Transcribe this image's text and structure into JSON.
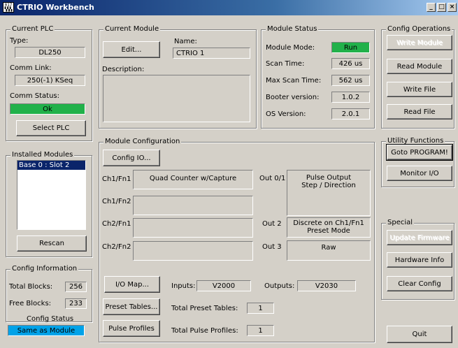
{
  "window": {
    "title": "CTRIO Workbench",
    "icon_text": "017 ▚▚▚"
  },
  "current_plc": {
    "label": "Current PLC",
    "type_label": "Type:",
    "type_value": "DL250",
    "comm_link_label": "Comm Link:",
    "comm_link_value": "250(-1) KSeq",
    "comm_status_label": "Comm Status:",
    "comm_status_value": "Ok",
    "select_plc": "Select PLC"
  },
  "installed_modules": {
    "label": "Installed Modules",
    "items": [
      "Base 0 : Slot 2"
    ],
    "rescan": "Rescan"
  },
  "config_info": {
    "label": "Config Information",
    "total_blocks_label": "Total Blocks:",
    "total_blocks_value": "256",
    "free_blocks_label": "Free Blocks:",
    "free_blocks_value": "233",
    "config_status_label": "Config Status",
    "config_status_value": "Same as Module"
  },
  "current_module": {
    "label": "Current Module",
    "edit": "Edit...",
    "name_label": "Name:",
    "name_value": "CTRIO 1",
    "description_label": "Description:"
  },
  "module_status": {
    "label": "Module Status",
    "mode_label": "Module Mode:",
    "mode_value": "Run",
    "scan_label": "Scan Time:",
    "scan_value": "426 us",
    "max_scan_label": "Max Scan Time:",
    "max_scan_value": "562 us",
    "booter_label": "Booter version:",
    "booter_value": "1.0.2",
    "os_label": "OS Version:",
    "os_value": "2.0.1"
  },
  "config_ops": {
    "label": "Config Operations",
    "write_module": "Write Module",
    "read_module": "Read Module",
    "write_file": "Write File",
    "read_file": "Read File"
  },
  "utility": {
    "label": "Utility Functions",
    "goto_program": "Goto PROGRAM!",
    "monitor_io": "Monitor I/O"
  },
  "special": {
    "label": "Special",
    "update_firmware": "Update Firmware",
    "hardware_info": "Hardware Info",
    "clear_config": "Clear Config"
  },
  "quit": "Quit",
  "module_config": {
    "label": "Module Configuration",
    "config_io": "Config IO...",
    "ch1fn1_label": "Ch1/Fn1",
    "ch1fn1_value": "Quad Counter w/Capture",
    "ch1fn2_label": "Ch1/Fn2",
    "ch2fn1_label": "Ch2/Fn1",
    "ch2fn2_label": "Ch2/Fn2",
    "out01_label": "Out 0/1",
    "out01_value_line1": "Pulse Output",
    "out01_value_line2": "Step / Direction",
    "out2_label": "Out 2",
    "out2_value_line1": "Discrete on Ch1/Fn1",
    "out2_value_line2": "Preset Mode",
    "out3_label": "Out 3",
    "out3_value": "Raw",
    "io_map": "I/O Map...",
    "inputs_label": "Inputs:",
    "inputs_value": "V2000",
    "outputs_label": "Outputs:",
    "outputs_value": "V2030",
    "preset_tables": "Preset Tables...",
    "total_preset_label": "Total Preset Tables:",
    "total_preset_value": "1",
    "pulse_profiles": "Pulse Profiles",
    "total_pulse_label": "Total Pulse Profiles:",
    "total_pulse_value": "1"
  },
  "colors": {
    "status_green": "#21b14a",
    "config_status_blue": "#00a2e8"
  }
}
